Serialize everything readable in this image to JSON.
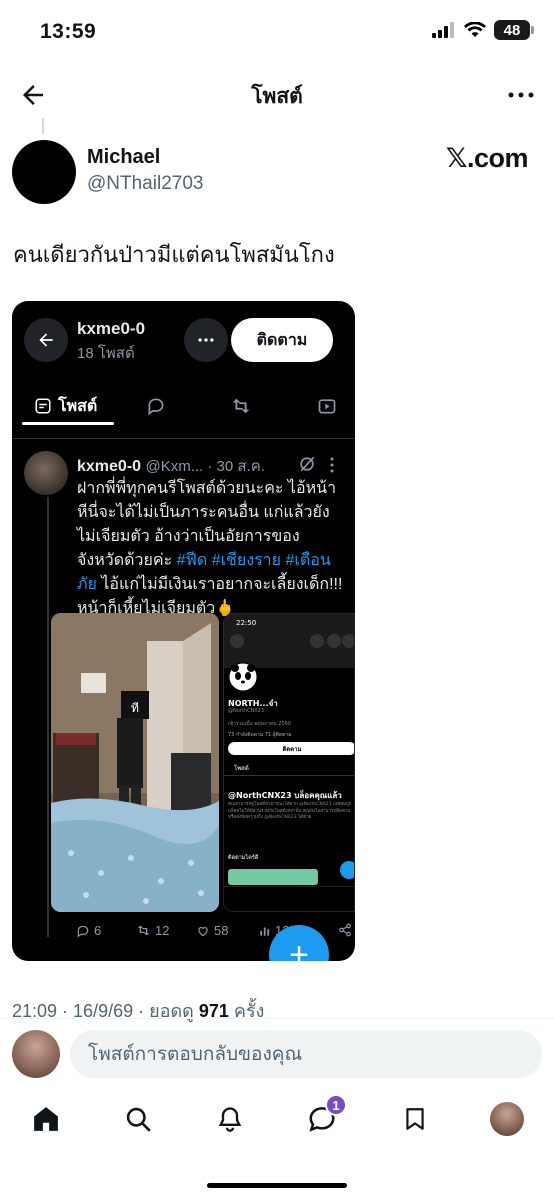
{
  "status_bar": {
    "time": "13:59",
    "battery": "48"
  },
  "header": {
    "title": "โพสต์"
  },
  "post": {
    "author_name": "Michael",
    "author_handle": "@NThail2703",
    "watermark": "𝕏.com",
    "text": "คนเดียวกันป่าวมีแต่คนโพสมันโกง",
    "timestamp": "21:09 · 16/9/69 · ยอดดู",
    "views": "971",
    "views_suffix": "ครั้ง"
  },
  "embedded": {
    "profile_name": "kxme0-0",
    "profile_posts": "18 โพสต์",
    "follow_label": "ติดตาม",
    "tab_posts": "โพสต์",
    "tweet_name": "kxme0-0",
    "tweet_meta": "@Kxm... · 30 ส.ค.",
    "tweet_text_1": "ฝากพี่พี่ทุกคนรีโพสต์ด้วยนะคะ ไอ้หน้าหีนี่จะได้ไม่เป็นภาระคนอื่น แก่แล้วยังไม่เจียมตัว อ้างว่าเป็นอัยการของจังหวัดด้วยค่ะ ",
    "hashtags": "#ฟีด #เชียงราย #เตือนภัย",
    "tweet_text_2": " ไอ้แก่ไม่มีเงินเราอยากจะเลี้ยงเด็ก!!! หน้าก็เหี้ยไม่เจียมตัว🖕",
    "replies": "6",
    "reposts": "12",
    "likes": "58",
    "views": "12",
    "inner": {
      "time": "22:50",
      "name": "NORTH...จ๋า",
      "handle": "@NorthCNX23",
      "joined": "เข้าร่วมเมื่อ พฤษภาคม 2560",
      "counts": "73 กำลังติดตาม  71 ผู้ติดตาม",
      "follow": "ติดตาม",
      "tab": "โพสต์",
      "blocked_title": "@NorthCNX23 บล็อคคุณแล้ว",
      "blocked_text": "คุณสามารถดูโพสต์สาธารณะได้จาก @NorthCNX23 แต่คุณถูกบล็อคไม่ให้มีส่วนร่วมกับโพสต์เหล่านั้น คุณยังไม่สามารถติดตามหรือส่งข้อความถึง @NorthCNX23 ได้ด้วย",
      "follow_suggest": "ติดตามไคร์ดี"
    }
  },
  "reply": {
    "placeholder": "โพสต์การตอบกลับของคุณ"
  },
  "tabbar": {
    "messages_badge": "1"
  }
}
